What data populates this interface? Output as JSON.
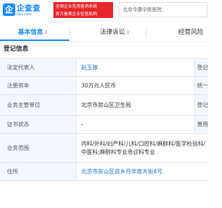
{
  "header": {
    "logo_glyph": "企",
    "logo_name": "企查查",
    "logo_url": "Qcc.com",
    "badge_line1": "全国企业信用查询系统",
    "badge_line2": "官方备案企业征信机构",
    "search_value": "北京今康中医医院"
  },
  "tabs": [
    {
      "label": "基本信息",
      "count": "3"
    },
    {
      "label": "法律诉讼",
      "count": "0"
    },
    {
      "label": "经营风险",
      "count": ""
    }
  ],
  "section_title": "登记信息",
  "rows": [
    {
      "label": "法定代表人",
      "value": "赵玉琢",
      "right_label": "登记"
    },
    {
      "label": "注册资本",
      "value": "30万元人民币",
      "right_label": "统一"
    },
    {
      "label": "业务主管单位",
      "value": "北京市房山区卫生局",
      "right_label": "登记"
    },
    {
      "label": "证书状态",
      "value": "-",
      "right_label": "曾用"
    },
    {
      "label": "业务范围",
      "value": "内科/外科/妇产科/儿科/口腔科/麻醉科/医学检验科/中医科;麻醉科专业急诊科专业",
      "right_label": ""
    },
    {
      "label": "住所",
      "value": "北京市房山区良乡月华南大街8号",
      "right_label": ""
    }
  ],
  "colors": {
    "accent": "#1a8cff",
    "badge_red": "#e5262a",
    "label_bg": "#f2f8fe"
  }
}
